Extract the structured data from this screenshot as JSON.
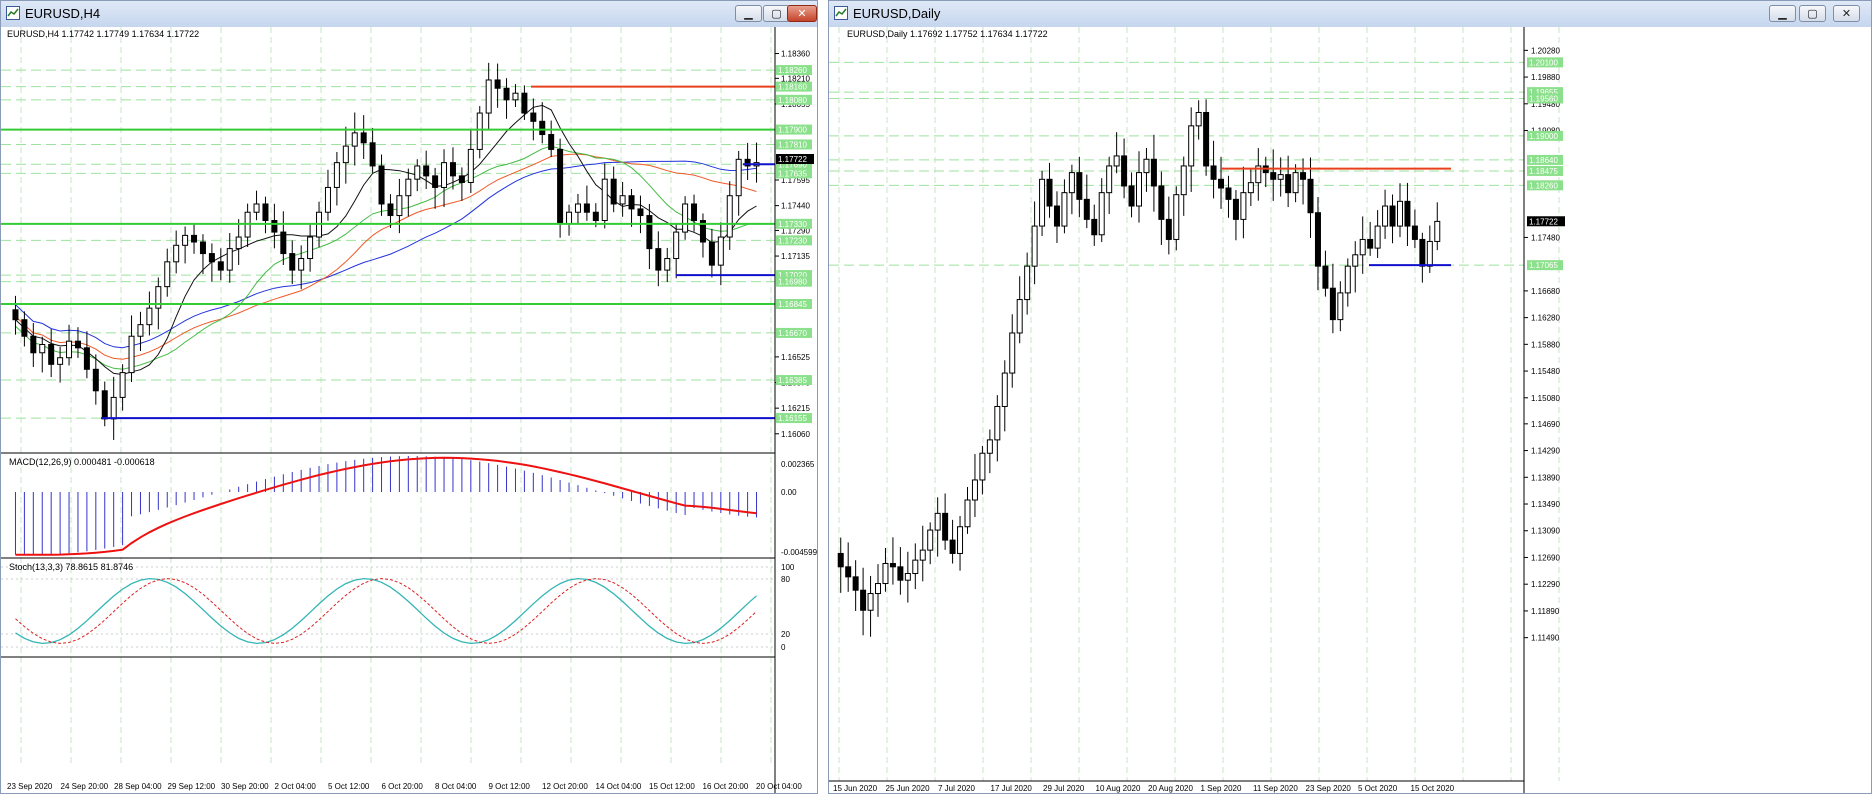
{
  "colors": {
    "grid": "#c8e6c8",
    "hline": "#9de29d",
    "green_line": "#33cc33",
    "red_line": "#e8401c",
    "blue_line": "#1010cc",
    "sma_blue": "#2233dd",
    "sma_red": "#f05a28",
    "sma_green": "#44bb44",
    "sma_black": "#111111",
    "macd_hist": "#3333cc",
    "macd_signal": "#ee1111",
    "stoch_main": "#33b5b5",
    "stoch_signal": "#dd2222",
    "label_bg": "#8be08b",
    "price_bg": "#000000"
  },
  "windows": {
    "left": {
      "title": "EURUSD,H4",
      "info": "EURUSD,H4  1.17742 1.17749 1.17634 1.17722",
      "macd_label": "MACD(12,26,9) 0.000481 -0.000618",
      "stoch_label": "Stoch(13,3,3) 78.8615 81.8746",
      "axis_labels": [
        "1.18360",
        "1.18210",
        "1.18055",
        "1.17595",
        "1.17440",
        "1.17290",
        "1.17135",
        "1.16525",
        "1.16370",
        "1.16215",
        "1.16060"
      ],
      "level_labels": [
        "1.18260",
        "1.18160",
        "1.18080",
        "1.17900",
        "1.17810",
        "1.17690",
        "1.17635",
        "1.17330",
        "1.17230",
        "1.17020",
        "1.16980",
        "1.16845",
        "1.16670",
        "1.16385",
        "1.16155"
      ],
      "current_price": "1.17722",
      "macd_axis": [
        "0.002365",
        "0.00",
        "-0.004599"
      ],
      "stoch_axis": [
        "100",
        "80",
        "20",
        "0"
      ],
      "time_labels": [
        "23 Sep 2020",
        "24 Sep 20:00",
        "28 Sep 04:00",
        "29 Sep 12:00",
        "30 Sep 20:00",
        "2 Oct 04:00",
        "5 Oct 12:00",
        "6 Oct 20:00",
        "8 Oct 04:00",
        "9 Oct 12:00",
        "12 Oct 20:00",
        "14 Oct 04:00",
        "15 Oct 12:00",
        "16 Oct 20:00",
        "20 Oct 04:00"
      ]
    },
    "right": {
      "title": "EURUSD,Daily",
      "info": "EURUSD,Daily  1.17692 1.17752 1.17634 1.17722",
      "axis_labels": [
        "1.20280",
        "1.19880",
        "1.19480",
        "1.19080",
        "1.17480",
        "1.16680",
        "1.16280",
        "1.15880",
        "1.15480",
        "1.15080",
        "1.14690",
        "1.14290",
        "1.13890",
        "1.13490",
        "1.13090",
        "1.12690",
        "1.12290",
        "1.11890",
        "1.11490"
      ],
      "level_labels": [
        "1.20100",
        "1.19655",
        "1.19560",
        "1.19000",
        "1.18640",
        "1.18475",
        "1.18260",
        "1.17065"
      ],
      "current_price": "1.17722",
      "time_labels": [
        "15 Jun 2020",
        "25 Jun 2020",
        "7 Jul 2020",
        "17 Jul 2020",
        "29 Jul 2020",
        "10 Aug 2020",
        "20 Aug 2020",
        "1 Sep 2020",
        "11 Sep 2020",
        "23 Sep 2020",
        "5 Oct 2020",
        "15 Oct 2020"
      ]
    }
  },
  "chart_data": [
    {
      "type": "candlestick",
      "symbol": "EURUSD",
      "timeframe": "H4",
      "ylim": [
        1.1598,
        1.1846
      ],
      "levels": {
        "green": [
          1.179,
          1.1733,
          1.16845
        ],
        "red": [
          1.1816
        ],
        "blue": [
          1.1702,
          1.16155,
          1.1769
        ]
      },
      "ohlc_close_path": [
        1.1675,
        1.1665,
        1.1655,
        1.166,
        1.1648,
        1.1652,
        1.1662,
        1.1658,
        1.1645,
        1.1632,
        1.1615,
        1.1628,
        1.1643,
        1.1665,
        1.1672,
        1.1682,
        1.1695,
        1.171,
        1.172,
        1.1726,
        1.1722,
        1.1715,
        1.171,
        1.1705,
        1.1718,
        1.1725,
        1.174,
        1.1745,
        1.1735,
        1.1728,
        1.1715,
        1.1705,
        1.1712,
        1.1725,
        1.174,
        1.1755,
        1.177,
        1.178,
        1.1788,
        1.1782,
        1.1768,
        1.1745,
        1.1738,
        1.175,
        1.176,
        1.1768,
        1.1762,
        1.1755,
        1.177,
        1.1762,
        1.1758,
        1.1778,
        1.18,
        1.182,
        1.1815,
        1.1808,
        1.1812,
        1.18,
        1.1795,
        1.1787,
        1.1778,
        1.1733,
        1.174,
        1.1745,
        1.174,
        1.1735,
        1.176,
        1.1745,
        1.175,
        1.1742,
        1.1738,
        1.1718,
        1.1705,
        1.1712,
        1.1728,
        1.1745,
        1.1735,
        1.1722,
        1.1708,
        1.1725,
        1.175,
        1.1772,
        1.1768,
        1.177
      ],
      "indicators": [
        "SMA blue",
        "SMA red",
        "SMA green",
        "SMA black",
        "MACD(12,26,9)",
        "Stoch(13,3,3)"
      ]
    },
    {
      "type": "candlestick",
      "symbol": "EURUSD",
      "timeframe": "Daily",
      "ylim": [
        1.1135,
        1.2042
      ],
      "levels": {
        "red": [
          1.1851
        ],
        "blue": [
          1.17065
        ]
      },
      "close_path": [
        1.1255,
        1.124,
        1.122,
        1.119,
        1.1215,
        1.123,
        1.126,
        1.1255,
        1.1235,
        1.1245,
        1.1265,
        1.128,
        1.131,
        1.1335,
        1.1295,
        1.1275,
        1.1315,
        1.1355,
        1.1385,
        1.1425,
        1.1445,
        1.1495,
        1.1545,
        1.1605,
        1.1655,
        1.1705,
        1.1765,
        1.1835,
        1.1795,
        1.1765,
        1.1815,
        1.1845,
        1.1805,
        1.1775,
        1.1752,
        1.1815,
        1.1855,
        1.187,
        1.1825,
        1.1795,
        1.1845,
        1.1865,
        1.1825,
        1.1775,
        1.1745,
        1.1812,
        1.1855,
        1.1915,
        1.1935,
        1.1855,
        1.1835,
        1.1822,
        1.1805,
        1.1775,
        1.1815,
        1.183,
        1.1855,
        1.1845,
        1.1835,
        1.1842,
        1.1815,
        1.1845,
        1.1835,
        1.1785,
        1.1705,
        1.1672,
        1.1625,
        1.1665,
        1.1705,
        1.1722,
        1.1745,
        1.1732,
        1.1765,
        1.1795,
        1.1765,
        1.1802,
        1.1765,
        1.1745,
        1.1705,
        1.1742,
        1.1772
      ]
    }
  ]
}
